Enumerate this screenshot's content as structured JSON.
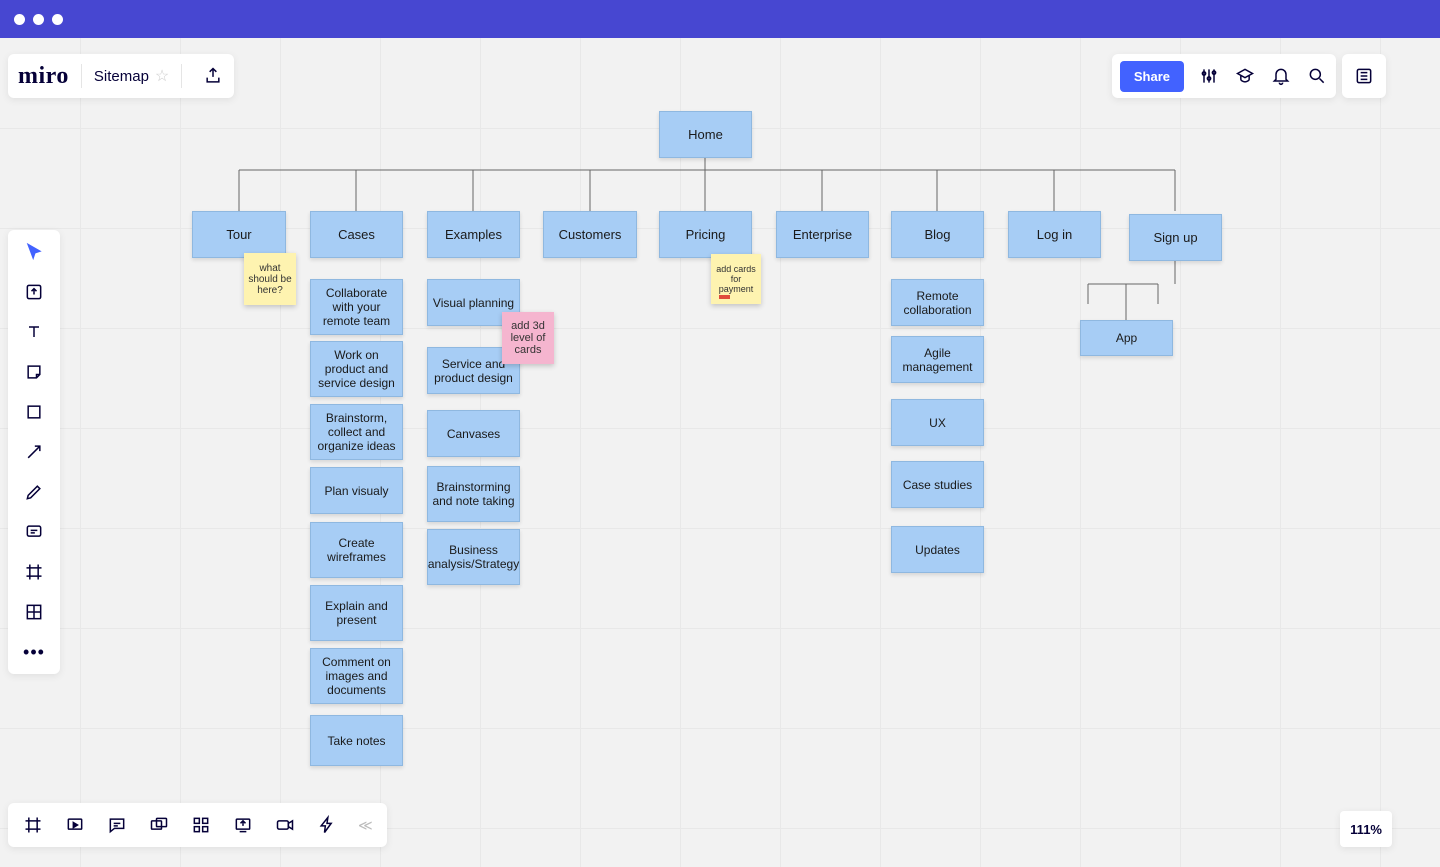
{
  "app": {
    "logo": "miro",
    "board_name": "Sitemap"
  },
  "header": {
    "share": "Share"
  },
  "zoom": "111%",
  "sitemap": {
    "root": "Home",
    "columns": [
      {
        "key": "tour",
        "label": "Tour",
        "children": []
      },
      {
        "key": "cases",
        "label": "Cases",
        "children": [
          "Collaborate with your remote team",
          "Work on product and service design",
          "Brainstorm, collect and organize ideas",
          "Plan visualy",
          "Create wireframes",
          "Explain and present",
          "Comment on images and documents",
          "Take notes"
        ]
      },
      {
        "key": "examples",
        "label": "Examples",
        "children": [
          "Visual planning",
          "Service and product design",
          "Canvases",
          "Brainstorming and note taking",
          "Business analysis/Strategy"
        ]
      },
      {
        "key": "customers",
        "label": "Customers",
        "children": []
      },
      {
        "key": "pricing",
        "label": "Pricing",
        "children": []
      },
      {
        "key": "enterprise",
        "label": "Enterprise",
        "children": []
      },
      {
        "key": "blog",
        "label": "Blog",
        "children": [
          "Remote collaboration",
          "Agile management",
          "UX",
          "Case studies",
          "Updates"
        ]
      },
      {
        "key": "login",
        "label": "Log in",
        "children": []
      },
      {
        "key": "signup",
        "label": "Sign up",
        "children": [
          "App"
        ]
      }
    ]
  },
  "stickies": {
    "tour_note": "what should be here?",
    "pricing_note": "add cards for payment",
    "examples_note": "add 3d level of cards"
  }
}
